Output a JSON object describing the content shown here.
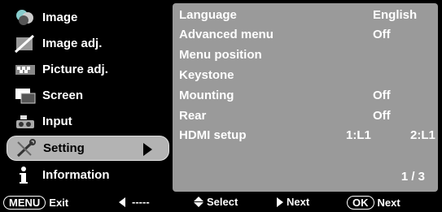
{
  "menu": {
    "items": [
      {
        "label": "Image",
        "icon": "image-icon"
      },
      {
        "label": "Image adj.",
        "icon": "image-adj-icon"
      },
      {
        "label": "Picture adj.",
        "icon": "picture-adj-icon"
      },
      {
        "label": "Screen",
        "icon": "screen-icon"
      },
      {
        "label": "Input",
        "icon": "input-icon"
      },
      {
        "label": "Setting",
        "icon": "setting-icon",
        "selected": true
      },
      {
        "label": "Information",
        "icon": "information-icon"
      }
    ]
  },
  "panel": {
    "rows": [
      {
        "label": "Language",
        "value": "English"
      },
      {
        "label": "Advanced menu",
        "value": "Off"
      },
      {
        "label": "Menu position",
        "value": ""
      },
      {
        "label": "Keystone",
        "value": ""
      },
      {
        "label": "Mounting",
        "value": "Off"
      },
      {
        "label": "Rear",
        "value": "Off"
      },
      {
        "label": "HDMI setup",
        "value": "1:L1",
        "value2": "2:L1"
      }
    ],
    "page_indicator": "1 / 3"
  },
  "footer": {
    "menu_key": "MENU",
    "exit_label": "Exit",
    "back_label": "-----",
    "select_label": "Select",
    "next_label": "Next",
    "ok_key": "OK",
    "ok_label": "Next"
  },
  "colors": {
    "background": "#000000",
    "panel": "#9a9a9a",
    "selected": "#b3b3b3",
    "text": "#ffffff"
  }
}
